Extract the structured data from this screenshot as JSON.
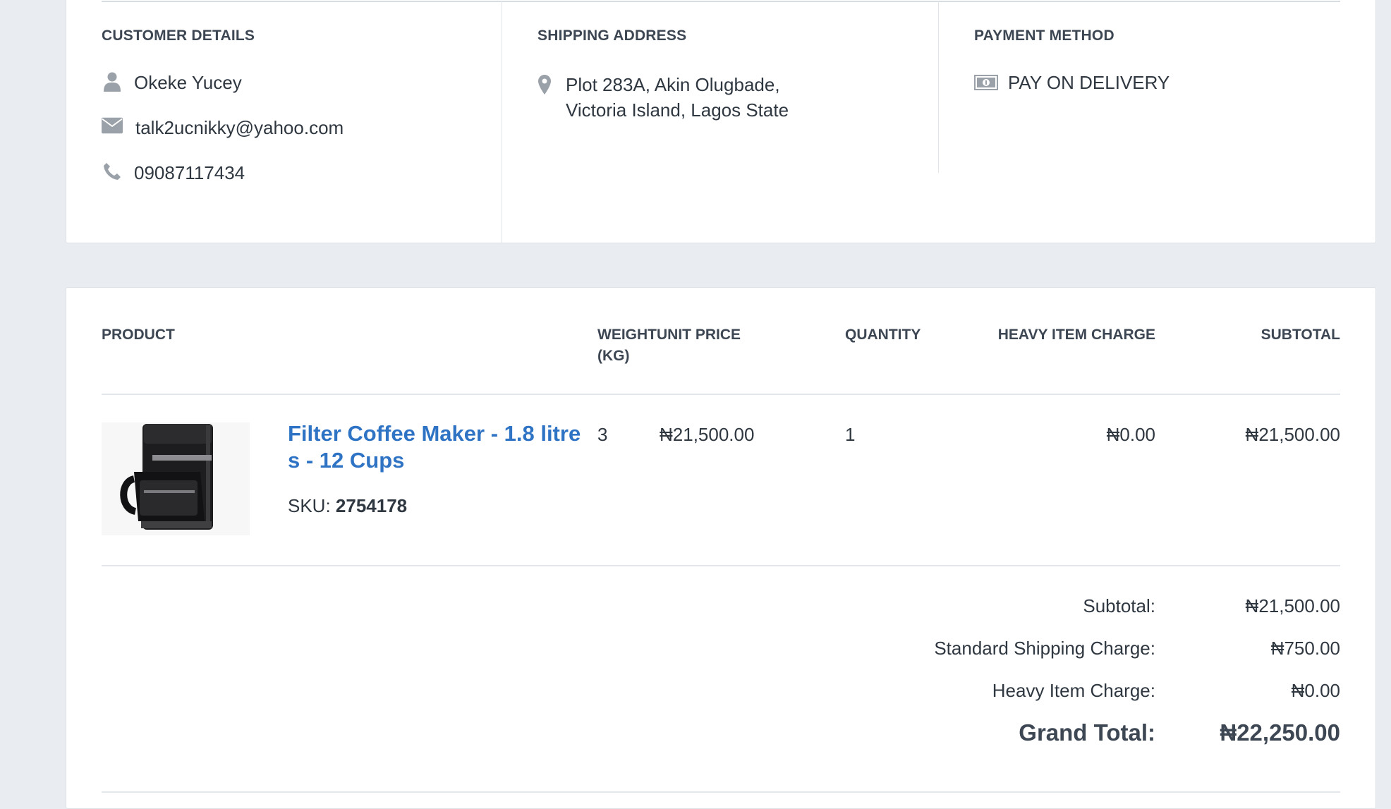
{
  "customer": {
    "heading": "CUSTOMER DETAILS",
    "name": "Okeke Yucey",
    "email": "talk2ucnikky@yahoo.com",
    "phone": "09087117434",
    "icons": {
      "name": "user-icon",
      "email": "envelope-icon",
      "phone": "phone-icon"
    }
  },
  "shipping": {
    "heading": "SHIPPING ADDRESS",
    "address_line1": "Plot 283A, Akin Olugbade,",
    "address_line2": "Victoria Island, Lagos State",
    "icon": "map-marker-icon"
  },
  "payment": {
    "heading": "PAYMENT METHOD",
    "method": "PAY ON DELIVERY",
    "icon": "money-icon"
  },
  "table": {
    "headers": {
      "product": "PRODUCT",
      "weight_line1": "WEIGHT",
      "weight_line2": "(KG)",
      "unit_price": "UNIT PRICE",
      "quantity": "QUANTITY",
      "heavy_charge": "HEAVY ITEM CHARGE",
      "subtotal": "SUBTOTAL"
    },
    "rows": [
      {
        "name_line1": "Filter Coffee Maker - 1.8 litre",
        "name_line2": "s - 12 Cups",
        "sku_label": "SKU:",
        "sku": "2754178",
        "weight": "3",
        "unit_price": "₦21,500.00",
        "quantity": "1",
        "heavy_charge": "₦0.00",
        "subtotal": "₦21,500.00"
      }
    ]
  },
  "summary": {
    "subtotal_label": "Subtotal:",
    "subtotal": "₦21,500.00",
    "shipping_label": "Standard Shipping Charge:",
    "shipping": "₦750.00",
    "heavy_label": "Heavy Item Charge:",
    "heavy": "₦0.00",
    "grand_label": "Grand Total:",
    "grand": "₦22,250.00"
  },
  "colors": {
    "link": "#2f73c4",
    "background": "#e9edf1",
    "heading": "#3d4653"
  }
}
